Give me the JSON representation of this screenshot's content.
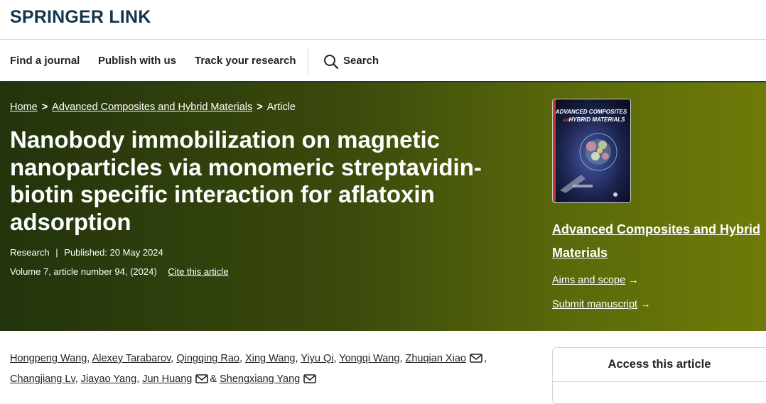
{
  "header": {
    "logo": "SPRINGER LINK"
  },
  "nav": {
    "items": [
      "Find a journal",
      "Publish with us",
      "Track your research"
    ],
    "search_label": "Search"
  },
  "breadcrumb": {
    "home": "Home",
    "journal": "Advanced Composites and Hybrid Materials",
    "current": "Article",
    "separator": ">"
  },
  "article": {
    "title": "Nanobody immobilization on magnetic nanoparticles via monomeric streptavidin-biotin specific interaction for aflatoxin adsorption",
    "type": "Research",
    "meta_sep": "|",
    "published": "Published: 20 May 2024",
    "volume": "Volume 7, article number 94, (2024)",
    "cite": "Cite this article"
  },
  "sidebar": {
    "cover_line1": "ADVANCED COMPOSITES",
    "cover_line2_prefix": "and",
    "cover_line2": "HYBRID MATERIALS",
    "journal_title": "Advanced Composites and Hybrid Materials",
    "aims": "Aims and scope",
    "submit": "Submit manuscript",
    "arrow": "→"
  },
  "authors": {
    "list": [
      "Hongpeng Wang",
      "Alexey Tarabarov",
      "Qingqing Rao",
      "Xing Wang",
      "Yiyu Qi",
      "Yongqi Wang",
      "Zhuqian Xiao",
      "Changjiang Lv",
      "Jiayao Yang",
      "Jun Huang",
      "Shengxiang Yang"
    ],
    "and": "&"
  },
  "access": {
    "title": "Access this article"
  },
  "colors": {
    "brand": "#12354f",
    "hero_start": "#23330c",
    "hero_end": "#6f7a08",
    "nav_border": "#0e3a52"
  },
  "icons": {
    "search": "search-icon",
    "mail": "mail-icon",
    "arrow": "arrow-right-icon"
  }
}
